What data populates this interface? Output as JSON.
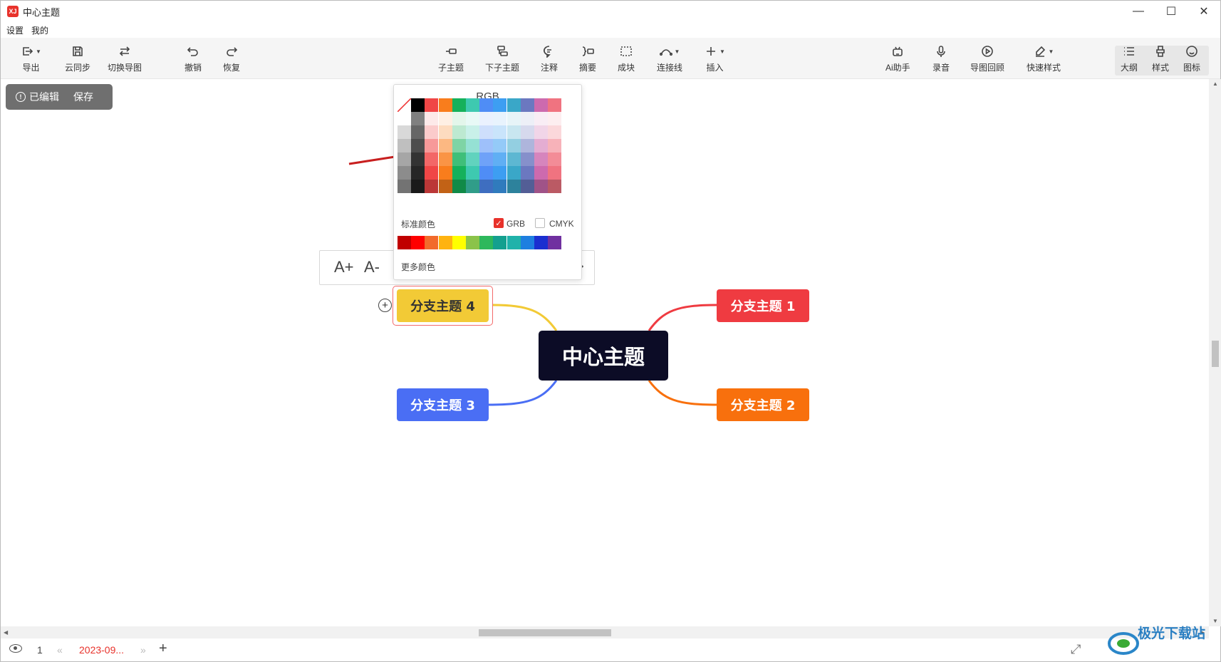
{
  "window": {
    "title": "中心主题",
    "logo_text": "XJ",
    "minimize": "—",
    "maximize": "☐",
    "close": "✕"
  },
  "menu": [
    "设置",
    "我的"
  ],
  "toolbar": {
    "export": "导出",
    "cloud_sync": "云同步",
    "switch_map": "切换导图",
    "undo": "撤销",
    "redo": "恢复",
    "subtopic": "子主题",
    "sub_subtopic": "下子主题",
    "note": "注释",
    "summary": "摘要",
    "block": "成块",
    "connector": "连接线",
    "insert": "插入",
    "ai": "Ai助手",
    "record": "录音",
    "review": "导图回顾",
    "quick_style": "快速样式",
    "outline": "大纲",
    "style": "样式",
    "icon": "图标"
  },
  "edit_badge": {
    "status": "已编辑",
    "save": "保存"
  },
  "mindmap": {
    "center": "中心主题",
    "branch1": "分支主题 1",
    "branch2": "分支主题 2",
    "branch3": "分支主题 3",
    "branch4": "分支主题 4",
    "colors": {
      "center": "#0c0c26",
      "b1": "#ef3b41",
      "b2": "#f8700d",
      "b3": "#4a6ef4",
      "b4": "#f2ca36"
    }
  },
  "format_bar": {
    "font_up": "A+",
    "font_down": "A-"
  },
  "color_picker": {
    "title": "RGB",
    "standard_label": "标准颜色",
    "grb_label": "GRB",
    "grb_checked": true,
    "cmyk_label": "CMYK",
    "cmyk_checked": false,
    "more_label": "更多颜色",
    "top_row": [
      "#000000",
      "#f04646",
      "#f97d1c",
      "#15b15b",
      "#3ec9b0",
      "#4f8df6",
      "#3d9ef2",
      "#3aa7c8",
      "#6b78c0",
      "#cd6aae",
      "#f07380"
    ],
    "standard_colors": [
      "#c00000",
      "#ff0000",
      "#f26a2b",
      "#ffb310",
      "#ffff00",
      "#8bc34a",
      "#2eb85c",
      "#14a08f",
      "#20b2aa",
      "#1e7fe0",
      "#1b2fd0",
      "#7030a0"
    ]
  },
  "status": {
    "page": "1",
    "tab": "2023-09...",
    "add": "+"
  },
  "watermark": "极光下载站"
}
